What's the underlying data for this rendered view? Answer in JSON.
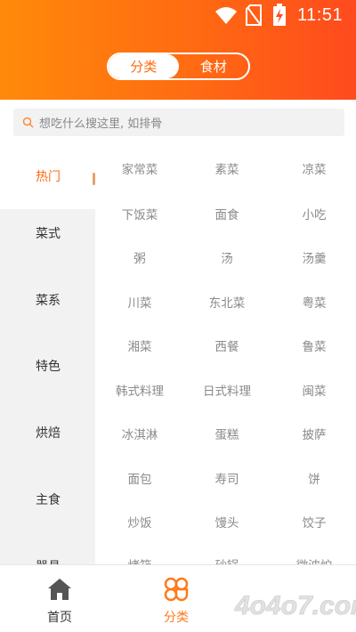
{
  "status_bar": {
    "time": "11:51"
  },
  "header": {
    "segments": [
      {
        "label": "分类",
        "active": true
      },
      {
        "label": "食材",
        "active": false
      }
    ]
  },
  "search": {
    "placeholder": "想吃什么搜这里, 如排骨"
  },
  "sidebar": {
    "items": [
      {
        "label": "热门",
        "active": true
      },
      {
        "label": "菜式"
      },
      {
        "label": "菜系"
      },
      {
        "label": "特色"
      },
      {
        "label": "烘焙"
      },
      {
        "label": "主食"
      },
      {
        "label": "器具"
      }
    ]
  },
  "categories": {
    "rows": [
      [
        "家常菜",
        "素菜",
        "凉菜"
      ],
      [
        "下饭菜",
        "面食",
        "小吃"
      ],
      [
        "粥",
        "汤",
        "汤羹"
      ],
      [
        "川菜",
        "东北菜",
        "粤菜"
      ],
      [
        "湘菜",
        "西餐",
        "鲁菜"
      ],
      [
        "韩式料理",
        "日式料理",
        "闽菜"
      ],
      [
        "冰淇淋",
        "蛋糕",
        "披萨"
      ],
      [
        "面包",
        "寿司",
        "饼"
      ],
      [
        "炒饭",
        "馒头",
        "饺子"
      ],
      [
        "烤箱",
        "砂锅",
        "微波炉"
      ]
    ]
  },
  "tabbar": {
    "tabs": [
      {
        "label": "首页",
        "icon": "home-icon"
      },
      {
        "label": "分类",
        "icon": "category-icon",
        "active": true
      }
    ]
  },
  "watermark": {
    "text": "4o4o7.com"
  },
  "colors": {
    "accent": "#ff6a12",
    "gradient_start": "#ff8a0a",
    "gradient_end": "#ff4a1e"
  }
}
